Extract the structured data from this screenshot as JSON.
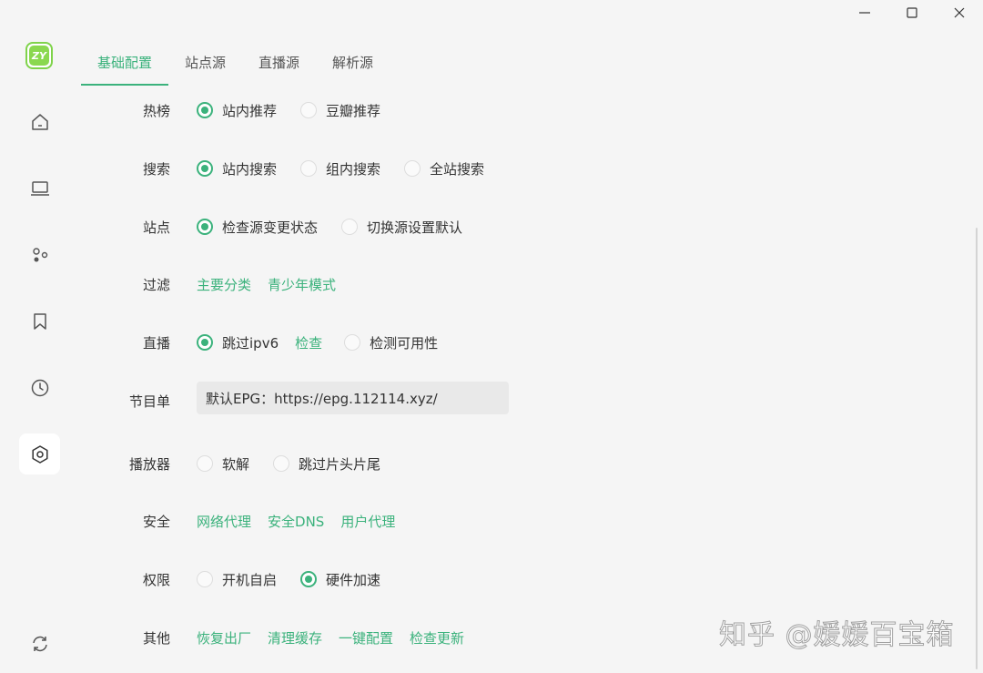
{
  "app": {
    "logo_text": "ZY",
    "accent_color": "#3bb27c"
  },
  "window_controls": [
    {
      "name": "minimize",
      "icon": "minimize-icon"
    },
    {
      "name": "maximize",
      "icon": "maximize-icon"
    },
    {
      "name": "close",
      "icon": "close-icon"
    }
  ],
  "sidebar": {
    "items": [
      {
        "id": "home",
        "icon": "home-icon",
        "active": false
      },
      {
        "id": "laptop",
        "icon": "laptop-icon",
        "active": false
      },
      {
        "id": "apps",
        "icon": "dots-icon",
        "active": false
      },
      {
        "id": "bookmark",
        "icon": "bookmark-icon",
        "active": false
      },
      {
        "id": "history",
        "icon": "clock-icon",
        "active": false
      },
      {
        "id": "settings",
        "icon": "settings-icon",
        "active": true
      }
    ],
    "bottom": {
      "id": "sync",
      "icon": "refresh-icon"
    }
  },
  "tabs": [
    {
      "label": "基础配置",
      "active": true
    },
    {
      "label": "站点源",
      "active": false
    },
    {
      "label": "直播源",
      "active": false
    },
    {
      "label": "解析源",
      "active": false
    }
  ],
  "settings": {
    "hot": {
      "label": "热榜",
      "options": [
        {
          "label": "站内推荐",
          "checked": true
        },
        {
          "label": "豆瓣推荐",
          "checked": false
        }
      ]
    },
    "search": {
      "label": "搜索",
      "options": [
        {
          "label": "站内搜索",
          "checked": true
        },
        {
          "label": "组内搜索",
          "checked": false
        },
        {
          "label": "全站搜索",
          "checked": false
        }
      ]
    },
    "site": {
      "label": "站点",
      "options": [
        {
          "label": "检查源变更状态",
          "checked": true
        },
        {
          "label": "切换源设置默认",
          "checked": false
        }
      ]
    },
    "filter": {
      "label": "过滤",
      "links": [
        "主要分类",
        "青少年模式"
      ]
    },
    "live": {
      "label": "直播",
      "option1": {
        "label": "跳过ipv6",
        "checked": true
      },
      "link": "检查",
      "option2": {
        "label": "检测可用性",
        "checked": false
      }
    },
    "epg": {
      "label": "节目单",
      "value": "默认EPG：https://epg.112114.xyz/"
    },
    "player": {
      "label": "播放器",
      "options": [
        {
          "label": "软解",
          "checked": false
        },
        {
          "label": "跳过片头片尾",
          "checked": false
        }
      ]
    },
    "security": {
      "label": "安全",
      "links": [
        "网络代理",
        "安全DNS",
        "用户代理"
      ]
    },
    "permission": {
      "label": "权限",
      "options": [
        {
          "label": "开机自启",
          "checked": false
        },
        {
          "label": "硬件加速",
          "checked": true
        }
      ]
    },
    "other": {
      "label": "其他",
      "links": [
        "恢复出厂",
        "清理缓存",
        "一键配置",
        "检查更新"
      ]
    }
  },
  "watermark": "知乎 @媛媛百宝箱"
}
